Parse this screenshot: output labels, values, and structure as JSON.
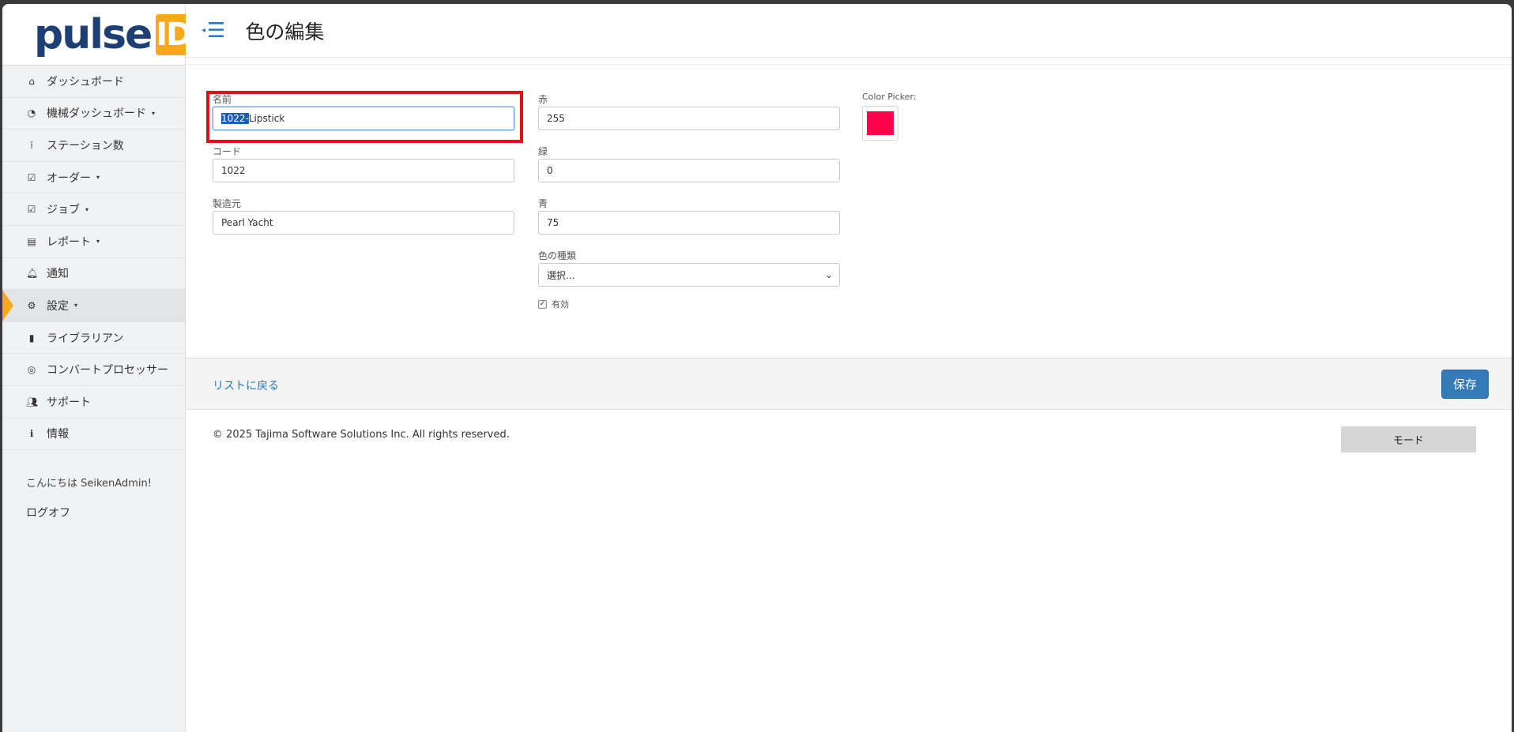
{
  "brand": {
    "text": "pulse",
    "box": "ID",
    "accent": "#f7a81b",
    "primary": "#1d3f73"
  },
  "sidebar": {
    "items": [
      {
        "label": "ダッシュボード",
        "icon": "home-icon",
        "glyph": "⌂",
        "caret": ""
      },
      {
        "label": "機械ダッシュボード",
        "icon": "gauge-icon",
        "glyph": "◔",
        "caret": "▾"
      },
      {
        "label": "ステーション数",
        "icon": "stations-icon",
        "glyph": "⁞",
        "caret": ""
      },
      {
        "label": "オーダー",
        "icon": "checkbox-icon",
        "glyph": "☑",
        "caret": "▾"
      },
      {
        "label": "ジョブ",
        "icon": "checkbox-icon",
        "glyph": "☑",
        "caret": "▾"
      },
      {
        "label": "レポート",
        "icon": "table-icon",
        "glyph": "▤",
        "caret": "▾"
      },
      {
        "label": "通知",
        "icon": "bell-icon",
        "glyph": "🔔︎",
        "caret": ""
      },
      {
        "label": "設定",
        "icon": "gear-icon",
        "glyph": "⚙",
        "caret": "▾",
        "active": true
      },
      {
        "label": "ライブラリアン",
        "icon": "book-icon",
        "glyph": "▮",
        "caret": ""
      },
      {
        "label": "コンバートプロセッサー",
        "icon": "target-icon",
        "glyph": "◎",
        "caret": ""
      },
      {
        "label": "サポート",
        "icon": "users-icon",
        "glyph": "👥︎",
        "caret": ""
      },
      {
        "label": "情報",
        "icon": "info-icon",
        "glyph": "ℹ",
        "caret": ""
      }
    ],
    "greeting": "こんにちは SeikenAdmin!",
    "logoff": "ログオフ"
  },
  "header": {
    "title": "色の編集",
    "toggle_arrow": "◂",
    "toggle_bars": "☰"
  },
  "form": {
    "name_label": "名前",
    "name_selected": "1022-",
    "name_rest": "Lipstick",
    "code_label": "コード",
    "code_value": "1022",
    "maker_label": "製造元",
    "maker_value": "Pearl Yacht",
    "red_label": "赤",
    "red_value": "255",
    "green_label": "緑",
    "green_value": "0",
    "blue_label": "青",
    "blue_value": "75",
    "type_label": "色の種類",
    "type_value": "選択...",
    "type_chevron": "⌄",
    "enabled_label": "有効",
    "enabled_check": "✓",
    "picker_label": "Color Picker:",
    "picker_color": "#ff004b"
  },
  "footer": {
    "back_link": "リストに戻る",
    "save": "保存",
    "copyright": "© 2025 Tajima Software Solutions Inc. All rights reserved.",
    "mode": "モード"
  }
}
